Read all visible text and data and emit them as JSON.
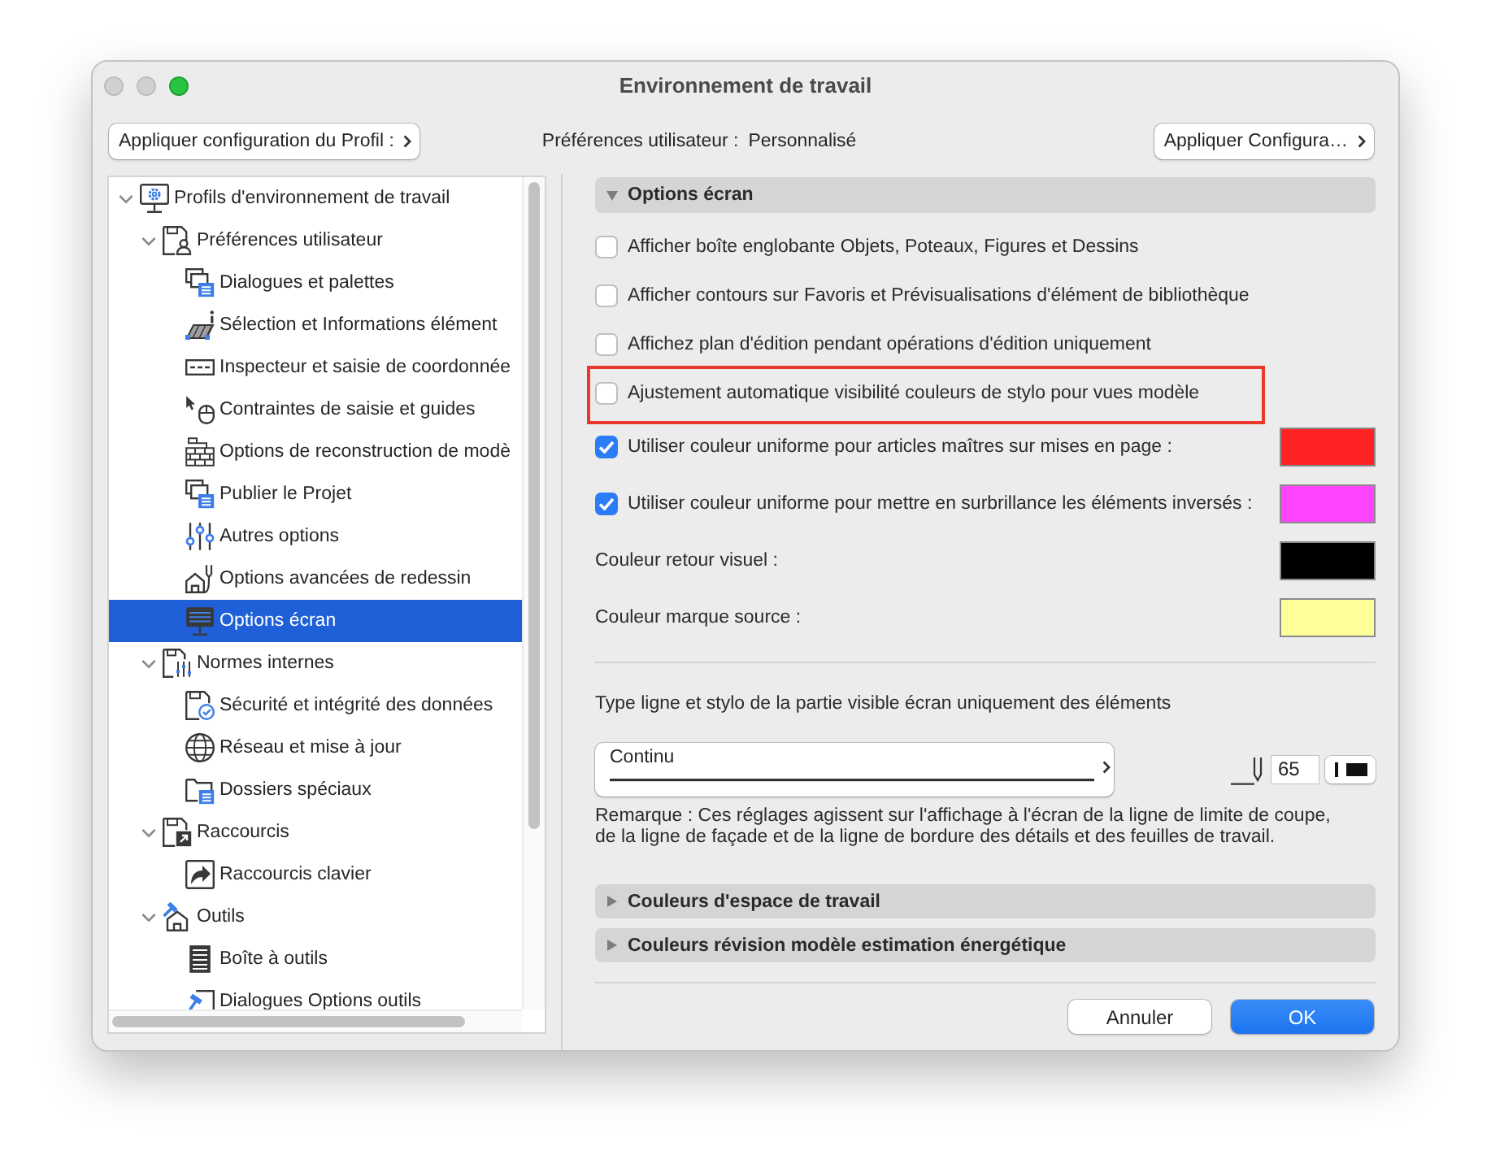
{
  "window": {
    "title": "Environnement de travail",
    "buttons": [
      {
        "kind": "close",
        "enabled": false
      },
      {
        "kind": "minimize",
        "enabled": false
      },
      {
        "kind": "zoom",
        "enabled": true
      }
    ]
  },
  "toolbar": {
    "apply_profile_button": "Appliquer configuration du Profil :",
    "profile_label": "Préférences utilisateur :",
    "profile_value": "Personnalisé",
    "apply_configuration_button": "Appliquer Configura…"
  },
  "tree": {
    "items": [
      {
        "label": "Profils d'environnement de travail",
        "expanded": true,
        "selected": false,
        "children": [
          {
            "label": "Préférences utilisateur",
            "expanded": true,
            "selected": false,
            "children": [
              {
                "label": "Dialogues et palettes",
                "selected": false
              },
              {
                "label": "Sélection et Informations élément",
                "selected": false
              },
              {
                "label": "Inspecteur et saisie de coordonnée",
                "selected": false
              },
              {
                "label": "Contraintes de saisie et guides",
                "selected": false
              },
              {
                "label": "Options de reconstruction de modè",
                "selected": false
              },
              {
                "label": "Publier le Projet",
                "selected": false
              },
              {
                "label": "Autres options",
                "selected": false
              },
              {
                "label": "Options avancées de redessin",
                "selected": false
              },
              {
                "label": "Options écran",
                "selected": true
              }
            ]
          },
          {
            "label": "Normes internes",
            "expanded": true,
            "selected": false,
            "children": [
              {
                "label": "Sécurité et intégrité des données",
                "selected": false
              },
              {
                "label": "Réseau et mise à jour",
                "selected": false
              },
              {
                "label": "Dossiers spéciaux",
                "selected": false
              }
            ]
          },
          {
            "label": "Raccourcis",
            "expanded": true,
            "selected": false,
            "children": [
              {
                "label": "Raccourcis clavier",
                "selected": false
              }
            ]
          },
          {
            "label": "Outils",
            "expanded": true,
            "selected": false,
            "children": [
              {
                "label": "Boîte à outils",
                "selected": false
              },
              {
                "label": "Dialogues Options outils",
                "selected": false
              }
            ]
          }
        ]
      }
    ]
  },
  "sections": [
    {
      "title": "Options écran",
      "expanded": true,
      "rows": [
        {
          "kind": "checkbox",
          "label": "Afficher boîte englobante Objets, Poteaux, Figures et Dessins",
          "checked": false,
          "highlighted": false
        },
        {
          "kind": "checkbox",
          "label": "Afficher contours sur Favoris et Prévisualisations d'élément de bibliothèque",
          "checked": false,
          "highlighted": false
        },
        {
          "kind": "checkbox",
          "label": "Affichez plan d'édition pendant opérations d'édition uniquement",
          "checked": false,
          "highlighted": false
        },
        {
          "kind": "checkbox",
          "label": "Ajustement automatique visibilité couleurs de stylo pour vues modèle",
          "checked": false,
          "highlighted": true
        },
        {
          "kind": "checkbox",
          "label": "Utiliser couleur uniforme pour articles maîtres sur mises en page :",
          "checked": true,
          "highlighted": false,
          "color": "#ff2222"
        },
        {
          "kind": "checkbox",
          "label": "Utiliser couleur uniforme pour mettre en surbrillance les éléments inversés :",
          "checked": true,
          "highlighted": false,
          "color": "#ff44ff"
        },
        {
          "kind": "color",
          "label": "Couleur retour visuel :",
          "highlighted": false,
          "color": "#000000"
        },
        {
          "kind": "color",
          "label": "Couleur marque source :",
          "highlighted": false,
          "color": "#ffff99"
        }
      ],
      "line_settings": {
        "label": "Type ligne et stylo de la partie visible écran uniquement des éléments",
        "line_type": "Continu",
        "pen_number": "65"
      },
      "note": "Remarque : Ces réglages agissent sur l'affichage à l'écran de la ligne de limite de coupe, de la ligne de façade et de la ligne de bordure des détails et des feuilles de travail."
    },
    {
      "title": "Couleurs d'espace de travail",
      "expanded": false
    },
    {
      "title": "Couleurs révision modèle estimation énergétique",
      "expanded": false
    }
  ],
  "buttons": [
    {
      "label": "Annuler",
      "kind": "cancel"
    },
    {
      "label": "OK",
      "kind": "default"
    }
  ]
}
